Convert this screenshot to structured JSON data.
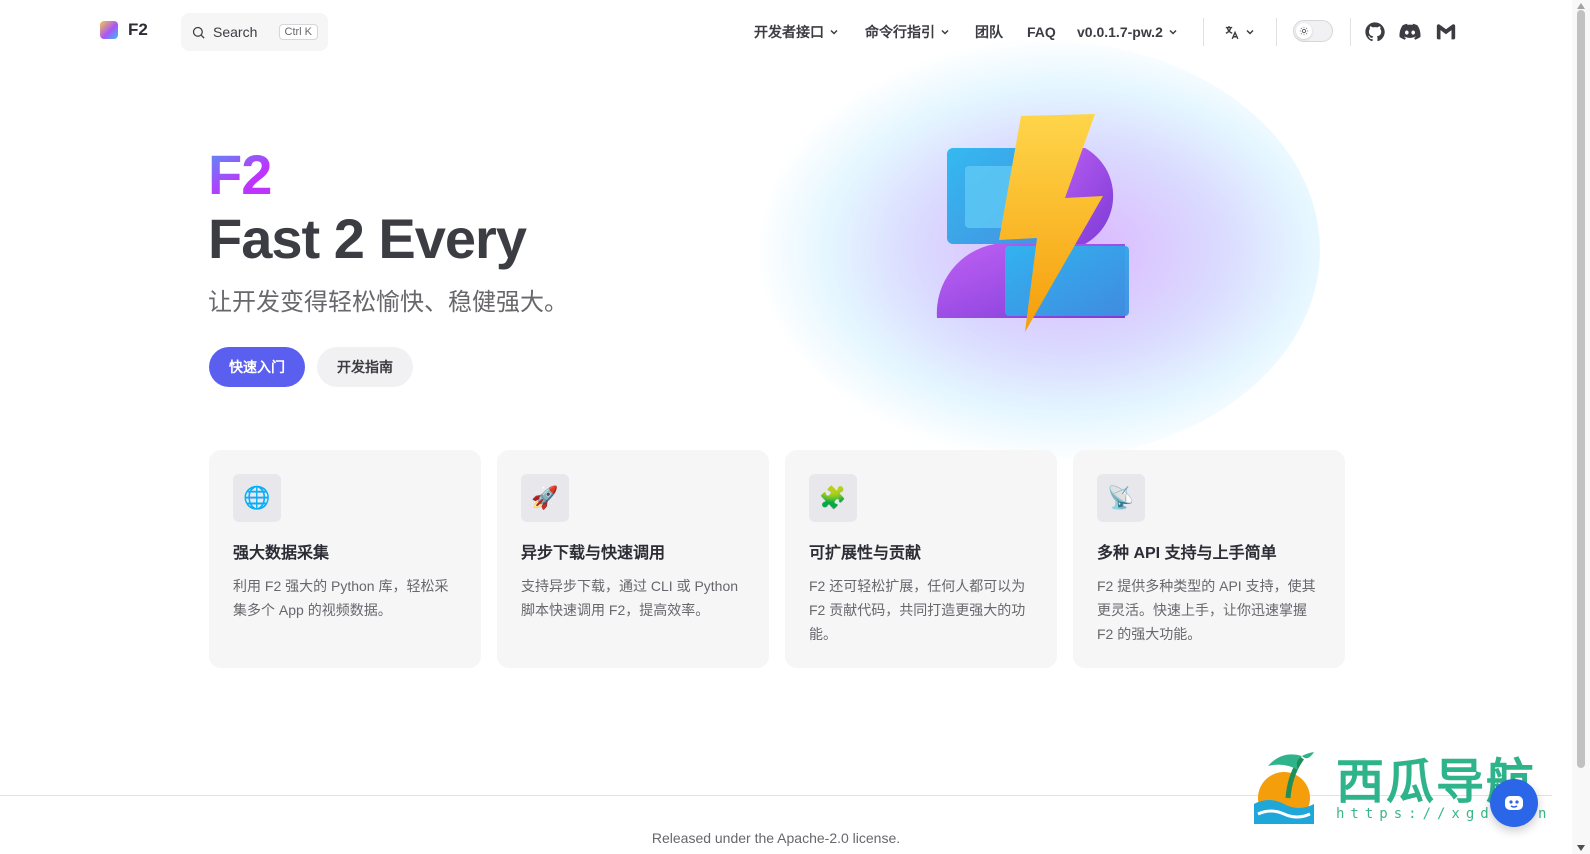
{
  "nav": {
    "brand": "F2",
    "search": {
      "label": "Search",
      "shortcut": "Ctrl K"
    },
    "menu": [
      {
        "label": "开发者接口",
        "dropdown": true
      },
      {
        "label": "命令行指引",
        "dropdown": true
      },
      {
        "label": "团队",
        "dropdown": false
      },
      {
        "label": "FAQ",
        "dropdown": false
      },
      {
        "label": "v0.0.1.7-pw.2",
        "dropdown": true
      }
    ],
    "language_icon": "translate-icon",
    "theme_toggle": "appearance-toggle",
    "social": [
      "github-icon",
      "discord-icon",
      "gmail-icon"
    ]
  },
  "hero": {
    "name": "F2",
    "text": "Fast 2 Every",
    "tagline": "让开发变得轻松愉快、稳健强大。",
    "actions": [
      {
        "label": "快速入门",
        "theme": "brand"
      },
      {
        "label": "开发指南",
        "theme": "alt"
      }
    ],
    "image": "f2-lightning-logo"
  },
  "features": [
    {
      "icon": "🌐",
      "title": "强大数据采集",
      "details": "利用 F2 强大的 Python 库，轻松采集多个 App 的视频数据。"
    },
    {
      "icon": "🚀",
      "title": "异步下载与快速调用",
      "details": "支持异步下载，通过 CLI 或 Python 脚本快速调用 F2，提高效率。"
    },
    {
      "icon": "🧩",
      "title": "可扩展性与贡献",
      "details": "F2 还可轻松扩展，任何人都可以为 F2 贡献代码，共同打造更强大的功能。"
    },
    {
      "icon": "📡",
      "title": "多种 API 支持与上手简单",
      "details": "F2 提供多种类型的 API 支持，使其更灵活。快速上手，让你迅速掌握 F2 的强大功能。"
    }
  ],
  "footer": {
    "message": "Released under the Apache-2.0 license."
  },
  "watermark": {
    "title": "西瓜导航",
    "url": "https://xgdh.cn"
  },
  "colors": {
    "brand": "#5b5ff0",
    "card_bg": "#f6f6f7",
    "text": "#3c3c43"
  }
}
